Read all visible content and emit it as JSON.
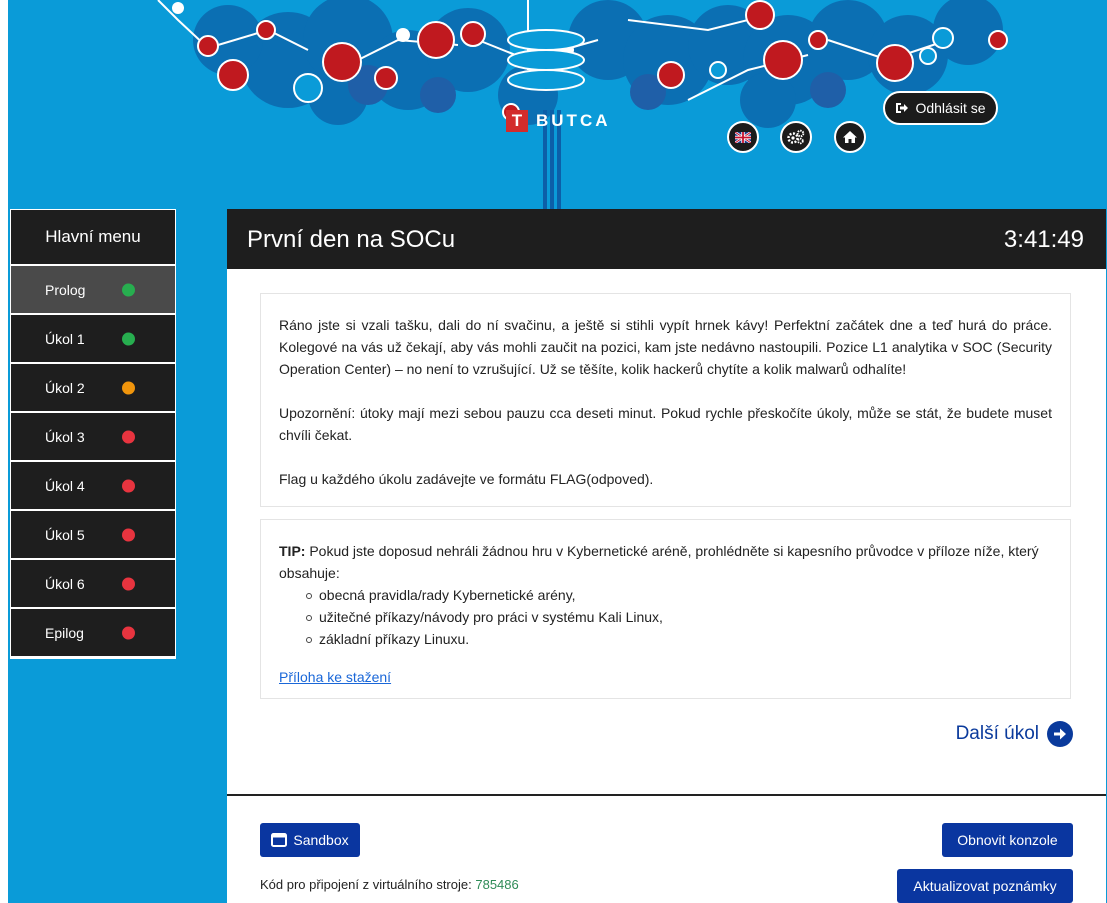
{
  "header": {
    "logo_badge": "T",
    "logo_text": "BUTCA",
    "logout_label": "Odhlásit se",
    "icons": [
      "uk-flag-icon",
      "gears-icon",
      "home-icon",
      "sign-out-icon"
    ]
  },
  "sidebar": {
    "title": "Hlavní menu",
    "items": [
      {
        "label": "Prolog",
        "status": "#27ae4f"
      },
      {
        "label": "Úkol 1",
        "status": "#27ae4f"
      },
      {
        "label": "Úkol 2",
        "status": "#f0950c"
      },
      {
        "label": "Úkol 3",
        "status": "#e8343f"
      },
      {
        "label": "Úkol 4",
        "status": "#e8343f"
      },
      {
        "label": "Úkol 5",
        "status": "#e8343f"
      },
      {
        "label": "Úkol 6",
        "status": "#e8343f"
      },
      {
        "label": "Epilog",
        "status": "#e8343f"
      }
    ]
  },
  "main": {
    "title": "První den na SOCu",
    "timer": "3:41:49",
    "intro": [
      "Ráno jste si vzali tašku, dali do ní svačinu, a ještě si stihli vypít hrnek kávy! Perfektní začátek dne a teď hurá do práce. Kolegové na vás už čekají, aby vás mohli zaučit na pozici, kam jste nedávno nastoupili. Pozice L1 analytika v SOC (Security Operation Center) – no není to vzrušující. Už se těšíte, kolik hackerů chytíte a kolik malwarů odhalíte!",
      "Upozornění: útoky mají mezi sebou pauzu cca deseti minut. Pokud rychle přeskočíte úkoly, může se stát, že budete muset chvíli čekat.",
      "Flag u každého úkolu zadávejte ve formátu FLAG(odpoved)."
    ],
    "tip": {
      "label": "TIP:",
      "text": " Pokud jste doposud nehráli žádnou hru v Kybernetické aréně, prohlédněte si kapesního průvodce v příloze níže, který obsahuje:",
      "bullets": [
        "obecná pravidla/rady Kybernetické arény,",
        "užitečné příkazy/návody pro práci v systému Kali Linux,",
        "základní příkazy Linuxu."
      ],
      "link": "Příloha ke stažení"
    },
    "next_task": "Další úkol"
  },
  "footer": {
    "sandbox": "Sandbox",
    "refresh_console": "Obnovit konzole",
    "update_notes": "Aktualizovat poznámky",
    "vm_code_label": "Kód pro připojení z virtuálního stroje:",
    "vm_code": "785486"
  }
}
